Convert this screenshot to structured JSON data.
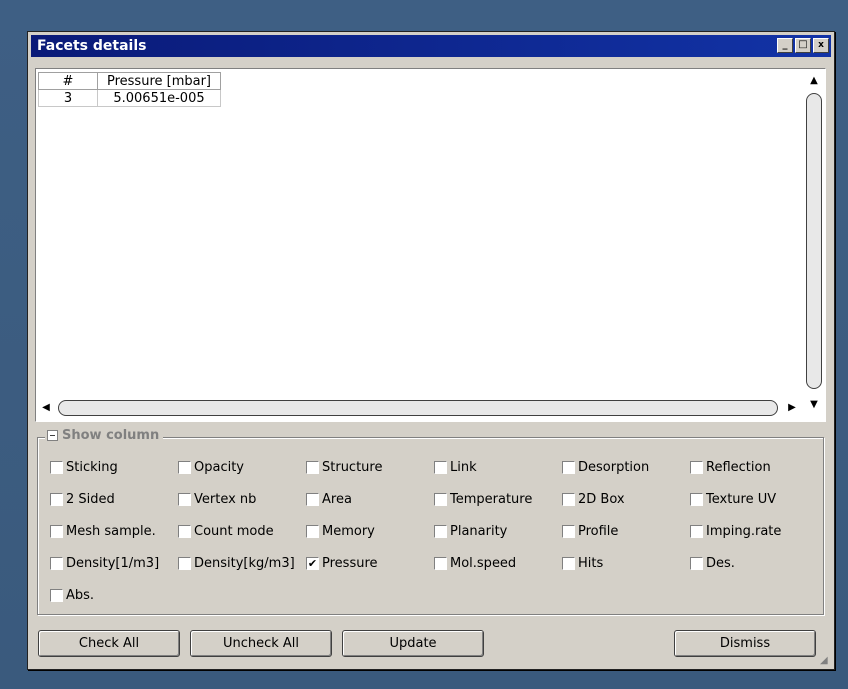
{
  "window": {
    "title": "Facets details"
  },
  "table": {
    "headers": [
      "#",
      "Pressure [mbar]"
    ],
    "rows": [
      [
        "3",
        "5.00651e-005"
      ]
    ]
  },
  "show_column": {
    "title": "Show column",
    "options": [
      {
        "label": "Sticking",
        "checked": false
      },
      {
        "label": "Opacity",
        "checked": false
      },
      {
        "label": "Structure",
        "checked": false
      },
      {
        "label": "Link",
        "checked": false
      },
      {
        "label": "Desorption",
        "checked": false
      },
      {
        "label": "Reflection",
        "checked": false
      },
      {
        "label": "2 Sided",
        "checked": false
      },
      {
        "label": "Vertex nb",
        "checked": false
      },
      {
        "label": "Area",
        "checked": false
      },
      {
        "label": "Temperature",
        "checked": false
      },
      {
        "label": "2D Box",
        "checked": false
      },
      {
        "label": "Texture UV",
        "checked": false
      },
      {
        "label": "Mesh sample.",
        "checked": false
      },
      {
        "label": "Count mode",
        "checked": false
      },
      {
        "label": "Memory",
        "checked": false
      },
      {
        "label": "Planarity",
        "checked": false
      },
      {
        "label": "Profile",
        "checked": false
      },
      {
        "label": "Imping.rate",
        "checked": false
      },
      {
        "label": "Density[1/m3]",
        "checked": false
      },
      {
        "label": "Density[kg/m3]",
        "checked": false
      },
      {
        "label": "Pressure",
        "checked": true
      },
      {
        "label": "Mol.speed",
        "checked": false
      },
      {
        "label": "Hits",
        "checked": false
      },
      {
        "label": "Des.",
        "checked": false
      },
      {
        "label": "Abs.",
        "checked": false
      }
    ]
  },
  "buttons": {
    "check_all": "Check All",
    "uncheck_all": "Uncheck All",
    "update": "Update",
    "dismiss": "Dismiss"
  },
  "icons": {
    "minimize": "minimize-icon",
    "maximize": "maximize-icon",
    "close": "close-icon",
    "collapse": "collapse-icon"
  }
}
